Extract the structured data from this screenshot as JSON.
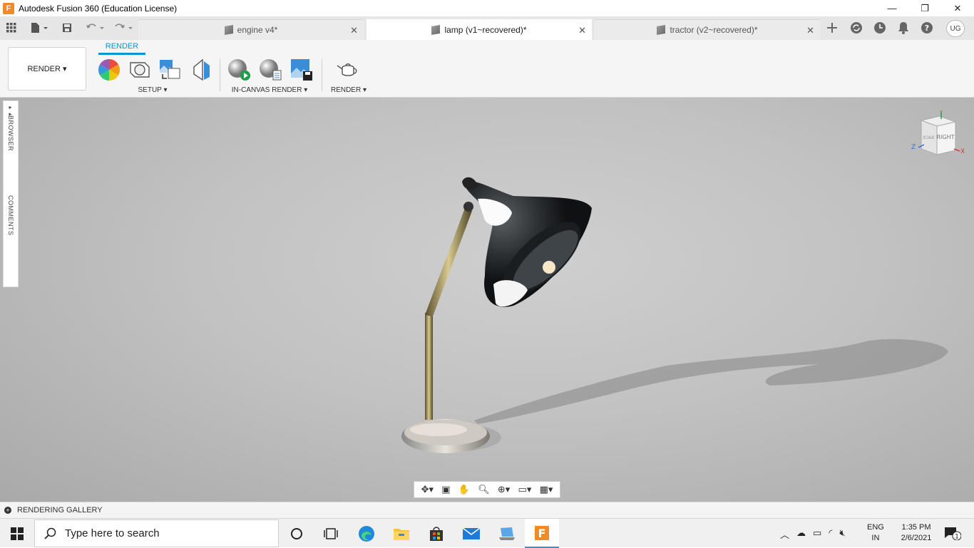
{
  "window": {
    "logo": "F",
    "title": "Autodesk Fusion 360 (Education License)",
    "minimize": "—",
    "restore": "❐",
    "close": "✕"
  },
  "tabs": [
    {
      "label": "engine v4*",
      "close": "✕"
    },
    {
      "label": "lamp (v1~recovered)*",
      "close": "✕"
    },
    {
      "label": "tractor (v2~recovered)*",
      "close": "✕"
    }
  ],
  "user_initials": "UG",
  "toolbar": {
    "workspace": "RENDER",
    "workspace_caret": "▾",
    "active_tab": "RENDER",
    "groups": {
      "setup": "SETUP",
      "in_canvas": "IN-CANVAS RENDER",
      "render": "RENDER"
    },
    "caret": "▾"
  },
  "side_panel": {
    "toggle": "▸▸",
    "browser": "BROWSER",
    "comments": "COMMENTS"
  },
  "viewcube": {
    "face": "RIGHT",
    "back": "BACK",
    "axis_y": "Y",
    "axis_z": "Z",
    "axis_x": "X"
  },
  "bottom_panel": {
    "plus": "+",
    "label": "RENDERING GALLERY"
  },
  "taskbar": {
    "search_placeholder": "Type here to search",
    "language_top": "ENG",
    "language_bottom": "IN",
    "time": "1:35 PM",
    "date": "2/6/2021",
    "notification_count": "1"
  },
  "colors": {
    "accent": "#0696d7",
    "fusion_orange": "#f08a24"
  }
}
